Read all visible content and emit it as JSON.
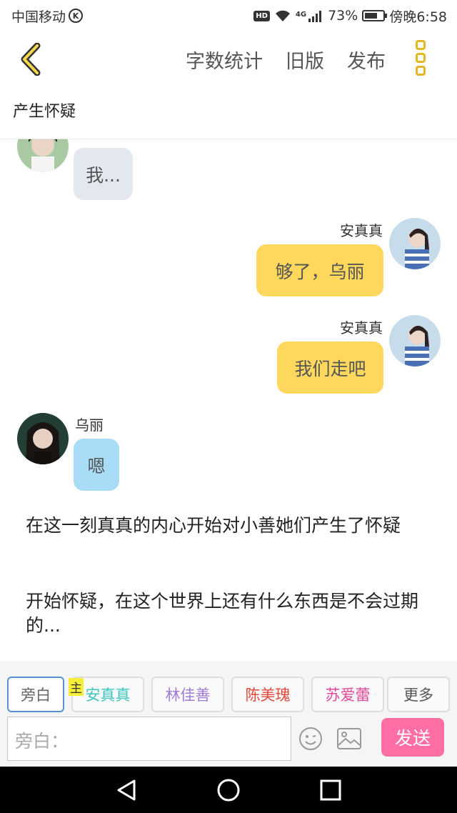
{
  "status_bar": {
    "carrier": "中国移动",
    "carrier_badge": "K",
    "hd": "HD",
    "network": "4G",
    "battery_percent": "73%",
    "battery_level": 0.73,
    "time": "傍晚6:58"
  },
  "header": {
    "actions": [
      "字数统计",
      "旧版",
      "发布"
    ],
    "accent_color": "#e2b722"
  },
  "chapter_title": "产生怀疑",
  "messages": [
    {
      "side": "left",
      "sender": "",
      "text": "我...",
      "style": "grey"
    },
    {
      "side": "right",
      "sender": "安真真",
      "text": "够了，乌丽",
      "style": "yellow"
    },
    {
      "side": "right",
      "sender": "安真真",
      "text": "我们走吧",
      "style": "yellow"
    },
    {
      "side": "left",
      "sender": "乌丽",
      "text": "嗯",
      "style": "blue"
    }
  ],
  "narrations": [
    "在这一刻真真的内心开始对小善她们产生了怀疑",
    "开始怀疑，在这个世界上还有什么东西是不会过期的..."
  ],
  "characters": {
    "main_tag": "主",
    "items": [
      {
        "label": "旁白",
        "color": "#666666",
        "active": true
      },
      {
        "label": "安真真",
        "color": "#3cc6c0",
        "active": false
      },
      {
        "label": "林佳善",
        "color": "#a07bd8",
        "active": false
      },
      {
        "label": "陈美瑰",
        "color": "#e0493b",
        "active": false
      },
      {
        "label": "苏爱蕾",
        "color": "#e0479a",
        "active": false
      },
      {
        "label": "更多",
        "color": "#555555",
        "active": false
      }
    ]
  },
  "input": {
    "placeholder": "旁白：",
    "send_label": "发送"
  }
}
